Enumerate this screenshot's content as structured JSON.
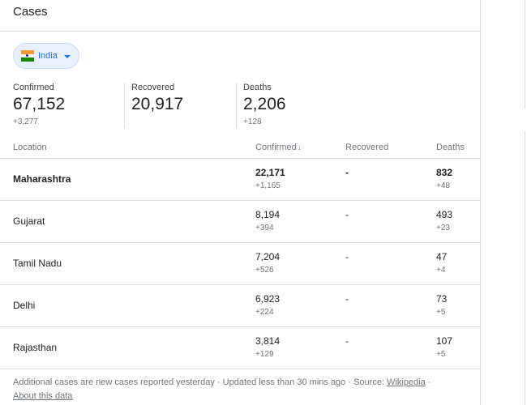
{
  "header": {
    "title": "Cases"
  },
  "country_selector": {
    "label": "India",
    "flag_icon": "india-flag-icon"
  },
  "stats": [
    {
      "label": "Confirmed",
      "value": "67,152",
      "delta": "+3,277"
    },
    {
      "label": "Recovered",
      "value": "20,917",
      "delta": ""
    },
    {
      "label": "Deaths",
      "value": "2,206",
      "delta": "+128"
    }
  ],
  "table": {
    "columns": {
      "location": "Location",
      "confirmed": "Confirmed",
      "recovered": "Recovered",
      "deaths": "Deaths"
    },
    "sort_indicator": "↓",
    "rows": [
      {
        "location": "Maharashtra",
        "confirmed": "22,171",
        "confirmed_delta": "+1,165",
        "recovered": "-",
        "deaths": "832",
        "deaths_delta": "+48"
      },
      {
        "location": "Gujarat",
        "confirmed": "8,194",
        "confirmed_delta": "+394",
        "recovered": "-",
        "deaths": "493",
        "deaths_delta": "+23"
      },
      {
        "location": "Tamil Nadu",
        "confirmed": "7,204",
        "confirmed_delta": "+526",
        "recovered": "-",
        "deaths": "47",
        "deaths_delta": "+4"
      },
      {
        "location": "Delhi",
        "confirmed": "6,923",
        "confirmed_delta": "+224",
        "recovered": "-",
        "deaths": "73",
        "deaths_delta": "+5"
      },
      {
        "location": "Rajasthan",
        "confirmed": "3,814",
        "confirmed_delta": "+129",
        "recovered": "-",
        "deaths": "107",
        "deaths_delta": "+5"
      }
    ]
  },
  "footer": {
    "note": "Additional cases are new cases reported yesterday",
    "sep1": " · ",
    "updated": "Updated less than 30 mins ago",
    "sep2": " · ",
    "source_label": "Source: ",
    "source_link": "Wikipedia",
    "sep3": " · ",
    "about_link": "About this data"
  },
  "colors": {
    "accent": "#1a73e8",
    "chip_bg": "#e8f0fe",
    "divider": "#dadce0",
    "muted": "#70757a"
  }
}
